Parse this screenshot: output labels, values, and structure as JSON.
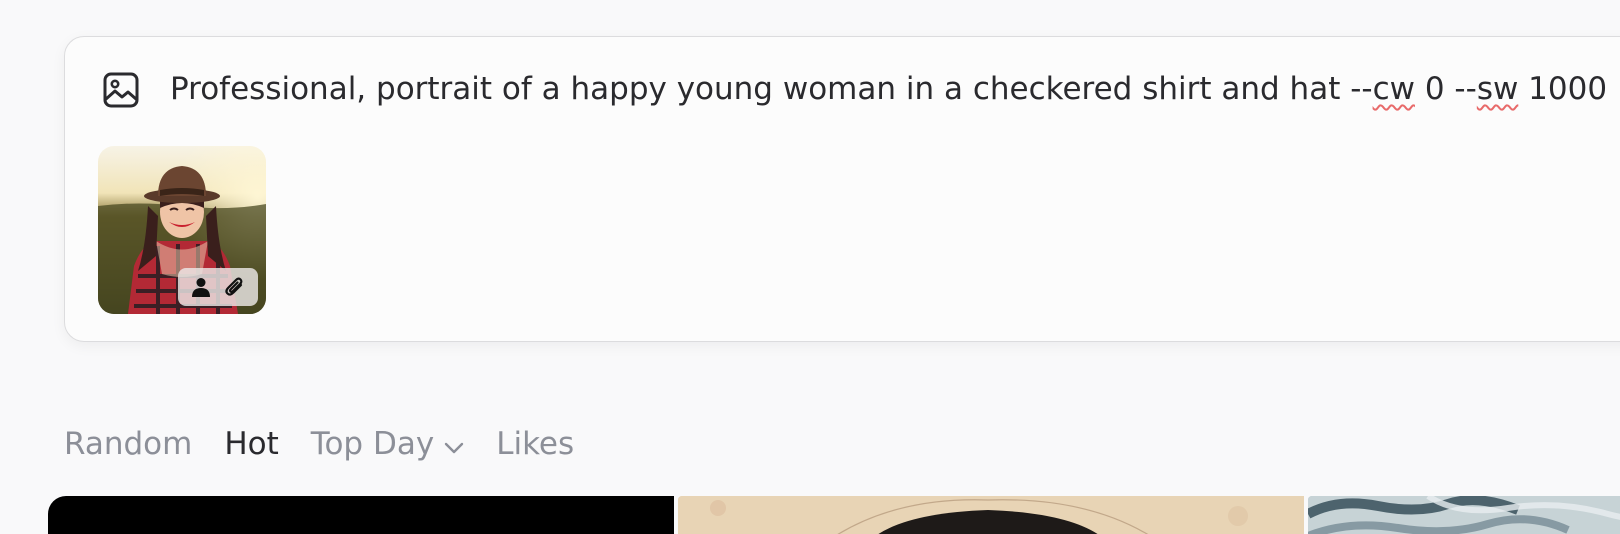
{
  "prompt": {
    "segments": [
      {
        "text": "Professional, portrait of a happy young woman in a checkered shirt and hat --",
        "misspelled": false
      },
      {
        "text": "cw",
        "misspelled": true
      },
      {
        "text": " 0 --",
        "misspelled": false
      },
      {
        "text": "sw",
        "misspelled": true
      },
      {
        "text": " 1000",
        "misspelled": false
      }
    ],
    "icon": "image-icon"
  },
  "reference_image": {
    "badge_icons": [
      "person-icon",
      "paperclip-icon"
    ]
  },
  "tabs": [
    {
      "label": "Random",
      "active": false
    },
    {
      "label": "Hot",
      "active": true
    },
    {
      "label": "Top Day",
      "active": false,
      "has_dropdown": true
    },
    {
      "label": "Likes",
      "active": false
    }
  ],
  "colors": {
    "text_dark": "#2a2a2e",
    "text_muted": "#8c8f98",
    "spellcheck": "#e86a6a",
    "background": "#f9f9fa"
  }
}
